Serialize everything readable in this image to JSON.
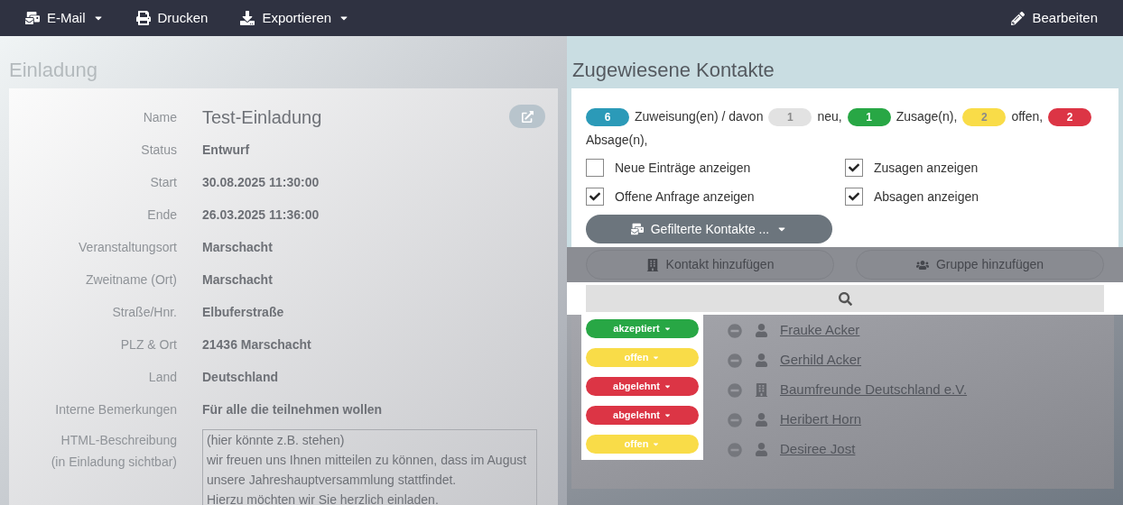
{
  "toolbar": {
    "items": [
      {
        "label": "E-Mail",
        "dropdown": true
      },
      {
        "label": "Drucken",
        "dropdown": false
      },
      {
        "label": "Exportieren",
        "dropdown": true
      }
    ],
    "edit": "Bearbeiten"
  },
  "invitation": {
    "title": "Einladung",
    "fields": [
      {
        "label": "Name",
        "value": "Test-Einladung",
        "kind": "title"
      },
      {
        "label": "Status",
        "value": "Entwurf"
      },
      {
        "label": "Start",
        "value": "30.08.2025 11:30:00"
      },
      {
        "label": "Ende",
        "value": "26.03.2025 11:36:00"
      },
      {
        "label": "Veranstaltungsort",
        "value": "Marschacht"
      },
      {
        "label": "Zweitname (Ort)",
        "value": "Marschacht"
      },
      {
        "label": "Straße/Hnr.",
        "value": "Elbuferstraße"
      },
      {
        "label": "PLZ & Ort",
        "value": "21436 Marschacht"
      },
      {
        "label": "Land",
        "value": "Deutschland"
      },
      {
        "label": "Interne Bemerkungen",
        "value": "Für alle die teilnehmen wollen"
      }
    ],
    "description": {
      "label_lines": [
        "HTML-Beschreibung",
        "(in Einladung sichtbar)"
      ],
      "lines": [
        "(hier könnte z.B. stehen)",
        "wir freuen uns Ihnen mitteilen zu können, dass im August",
        "unsere Jahreshauptversammlung stattfindet.",
        "Hierzu möchten wir Sie herzlich einladen."
      ]
    }
  },
  "contacts": {
    "title": "Zugewiesene Kontakte",
    "summary": [
      {
        "count": "6",
        "text": "Zuweisung(en) / davon",
        "color": "#2b9ab8"
      },
      {
        "count": "1",
        "text": "neu,",
        "color": "#e2e2e2"
      },
      {
        "count": "1",
        "text": "Zusage(n),",
        "color": "#28a745"
      },
      {
        "count": "2",
        "text": "offen,",
        "color": "#f9dc48"
      },
      {
        "count": "2",
        "text": "Absage(n),",
        "color": "#dc3545"
      }
    ],
    "filters": [
      {
        "label": "Neue Einträge anzeigen",
        "checked": false
      },
      {
        "label": "Zusagen anzeigen",
        "checked": true
      },
      {
        "label": "Offene Anfrage anzeigen",
        "checked": true
      },
      {
        "label": "Absagen anzeigen",
        "checked": true
      }
    ],
    "filtered_button": "Gefilterte Kontakte ...",
    "add_buttons": [
      "Kontakt hinzufügen",
      "Gruppe hinzufügen"
    ],
    "rows": [
      {
        "status": "akzeptiert",
        "color": "#28a745",
        "name": "Frauke Acker",
        "kind": "person"
      },
      {
        "status": "offen",
        "color": "#f9dc48",
        "name": "Gerhild Acker",
        "kind": "person"
      },
      {
        "status": "abgelehnt",
        "color": "#dc3545",
        "name": "Baumfreunde Deutschland e.V.",
        "kind": "organization"
      },
      {
        "status": "abgelehnt",
        "color": "#dc3545",
        "name": "Heribert Horn",
        "kind": "person"
      },
      {
        "status": "offen",
        "color": "#f9dc48",
        "name": "Desiree Jost",
        "kind": "person"
      }
    ]
  }
}
